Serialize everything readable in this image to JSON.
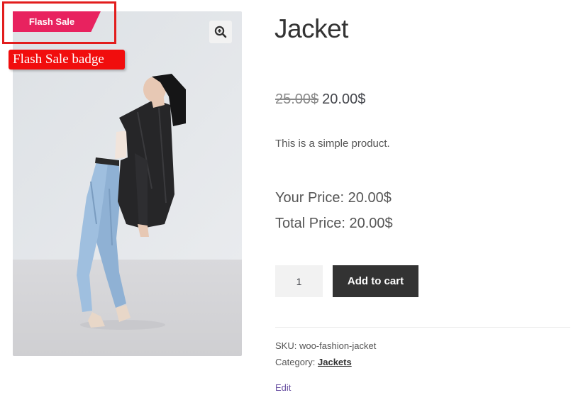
{
  "badge": {
    "label": "Flash Sale",
    "color": "#e8225f"
  },
  "annotation": {
    "label": "Flash Sale badge",
    "color": "#f10d0d"
  },
  "gallery": {
    "zoom_icon": "zoom-in-icon",
    "image": "product-photo-woman-in-black-blazer-and-jeans"
  },
  "product": {
    "title": "Jacket",
    "regular_price": "25.00$",
    "sale_price": "20.00$",
    "short_description": "This is a simple product.",
    "your_price": "Your Price: 20.00$",
    "total_price": "Total Price: 20.00$",
    "quantity": "1",
    "add_to_cart_label": "Add to cart",
    "sku_text": "SKU: woo-fashion-jacket",
    "category_prefix": "Category:",
    "category_link": "Jackets",
    "edit_label": "Edit"
  },
  "colors": {
    "button_bg": "#333333",
    "edit_link": "#6b52a3",
    "highlight": "#e21d1d"
  }
}
